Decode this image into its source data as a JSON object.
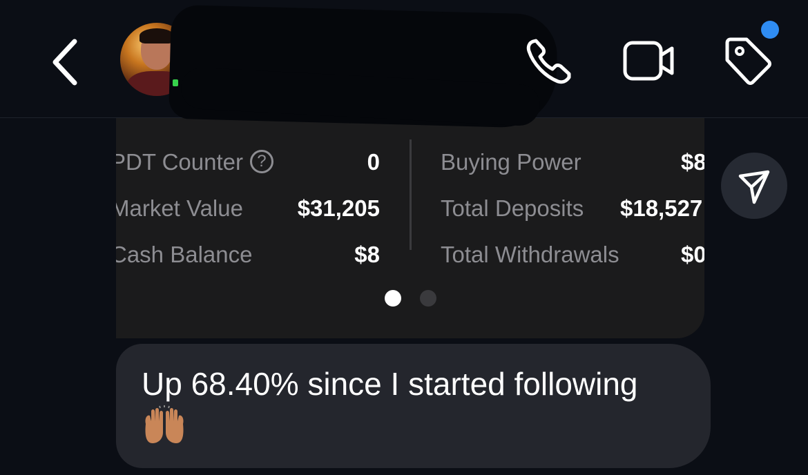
{
  "header": {
    "back_icon": "chevron-left-icon",
    "avatar_alt": "contact-avatar",
    "actions": [
      {
        "name": "phone-call-button",
        "icon": "phone-icon"
      },
      {
        "name": "video-call-button",
        "icon": "video-camera-icon"
      },
      {
        "name": "tag-button",
        "icon": "tag-icon"
      }
    ],
    "notification_color": "#2f8cf2"
  },
  "screenshot": {
    "left_stats": [
      {
        "label": "PDT Counter",
        "value": "0",
        "help": "?"
      },
      {
        "label": "Market Value",
        "value": "$31,205"
      },
      {
        "label": "Cash Balance",
        "value": "$8"
      }
    ],
    "right_stats": [
      {
        "label": "Buying Power",
        "value": "$8"
      },
      {
        "label": "Total Deposits",
        "value": "$18,527"
      },
      {
        "label": "Total Withdrawals",
        "value": "$0"
      }
    ],
    "pager": {
      "current": 1,
      "total": 2
    }
  },
  "message": {
    "text": "Up 68.40% since I started following",
    "emoji": "raising-hands-emoji"
  },
  "share_icon": "paper-plane-icon",
  "colors": {
    "background": "#0b0e15",
    "bubble": "#24262d",
    "card": "#1b1b1c",
    "label_gray": "#8d8d92"
  }
}
